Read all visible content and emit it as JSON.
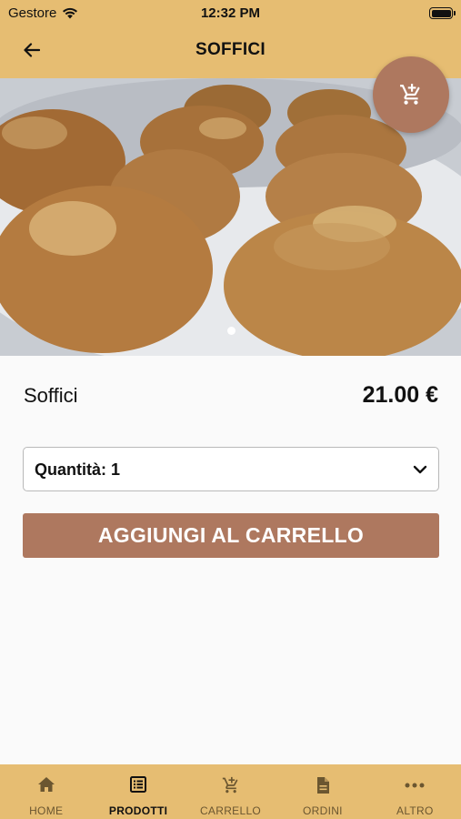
{
  "status_bar": {
    "carrier": "Gestore",
    "time": "12:32 PM"
  },
  "nav": {
    "title": "SOFFICI",
    "back_icon": "arrow-left-icon"
  },
  "fab": {
    "icon": "cart-icon"
  },
  "hero": {
    "carousel_pages": 1,
    "active_page": 1
  },
  "product": {
    "name": "Soffici",
    "price": "21.00 €"
  },
  "quantity": {
    "label": "Quantità: 1"
  },
  "add_button": {
    "label": "AGGIUNGI AL CARRELLO"
  },
  "tabs": [
    {
      "label": "HOME",
      "icon": "home-icon",
      "active": false
    },
    {
      "label": "PRODOTTI",
      "icon": "list-icon",
      "active": true
    },
    {
      "label": "CARRELLO",
      "icon": "cart-icon",
      "active": false
    },
    {
      "label": "ORDINI",
      "icon": "document-icon",
      "active": false
    },
    {
      "label": "ALTRO",
      "icon": "more-icon",
      "active": false
    }
  ],
  "colors": {
    "header": "#e6bd72",
    "accent": "#ae785f",
    "background": "#fafafa"
  }
}
